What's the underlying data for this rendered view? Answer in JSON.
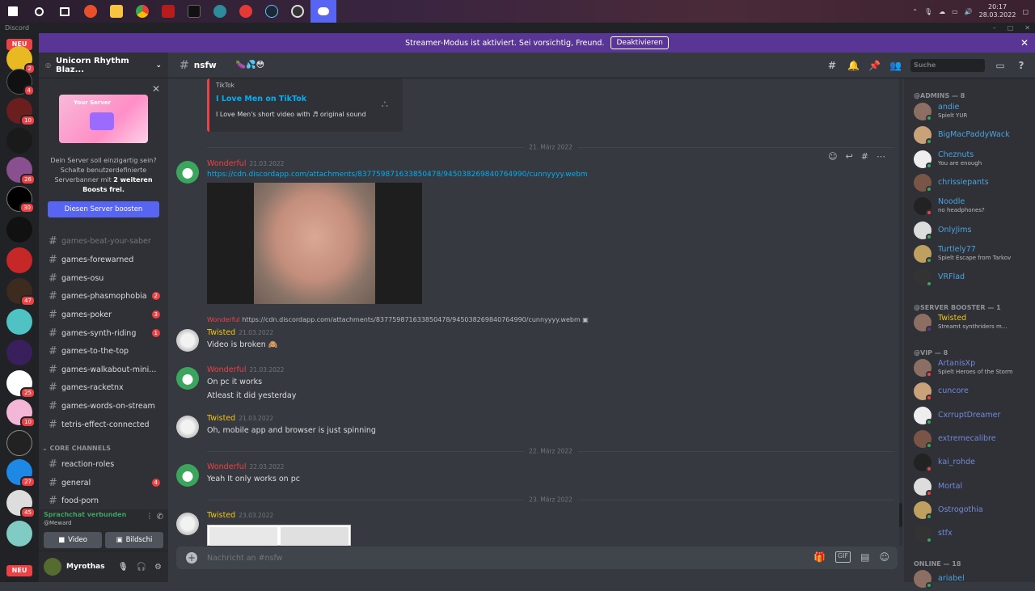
{
  "taskbar": {
    "clock_time": "20:17",
    "clock_date": "28.03.2022",
    "icons": [
      "windows-start-icon",
      "search-icon",
      "task-view-icon",
      "app-red-icon",
      "file-explorer-icon",
      "chrome-icon",
      "app-dark-red-icon",
      "terminal-icon",
      "app-blue-icon",
      "app-orange-icon",
      "steam-icon",
      "obs-icon",
      "discord-icon"
    ]
  },
  "app_title": "Discord",
  "banner": {
    "text": "Streamer-Modus ist aktiviert. Sei vorsichtig, Freund.",
    "button": "Deaktivieren"
  },
  "guilds": {
    "new_label": "NEU",
    "badges": [
      "2",
      "4",
      "10",
      "26",
      "30",
      "47",
      "25",
      "10",
      "27",
      "45"
    ]
  },
  "server": {
    "name": "Unicorn Rhythm Blaz...",
    "boost_text_1": "Dein Server soll einzigartig sein?",
    "boost_text_2": "Schalte benutzerdefinierte",
    "boost_text_3": "Serverbanner mit",
    "boost_bold": "2 weiteren",
    "boost_text_4": "Boosts frei.",
    "boost_image_label": "Your Server",
    "boost_button": "Diesen Server boosten"
  },
  "channels": [
    {
      "name": "games-beat-your-saber",
      "badge": ""
    },
    {
      "name": "games-forewarned",
      "badge": ""
    },
    {
      "name": "games-osu",
      "badge": ""
    },
    {
      "name": "games-phasmophobia",
      "badge": "2"
    },
    {
      "name": "games-poker",
      "badge": "3"
    },
    {
      "name": "games-synth-riding",
      "badge": "1"
    },
    {
      "name": "games-to-the-top",
      "badge": ""
    },
    {
      "name": "games-walkabout-mini...",
      "badge": ""
    },
    {
      "name": "games-racketnx",
      "badge": ""
    },
    {
      "name": "games-words-on-stream",
      "badge": ""
    },
    {
      "name": "tetris-effect-connected",
      "badge": ""
    }
  ],
  "category_core": "CORE CHANNELS",
  "core_channels": [
    {
      "name": "reaction-roles",
      "badge": ""
    },
    {
      "name": "general",
      "badge": "4"
    },
    {
      "name": "food-porn",
      "badge": ""
    }
  ],
  "voice": {
    "status": "Sprachchat verbunden",
    "channel": "@Meward",
    "video": "Video",
    "screen": "Bildschi"
  },
  "user": {
    "name": "Myrothas"
  },
  "chat": {
    "channel": "nsfw",
    "search_placeholder": "Suche",
    "composer_placeholder": "Nachricht an #nsfw",
    "gif_label": "GIF"
  },
  "embed": {
    "provider": "TikTok",
    "title": "I Love Men on TikTok",
    "description": "I Love Men's short video with ♬ original sound"
  },
  "dividers": [
    "21. März 2022",
    "22. März 2022",
    "23. März 2022"
  ],
  "messages": [
    {
      "author": "Wonderful",
      "time": "21.03.2022",
      "text": "https://cdn.discordapp.com/attachments/837759871633850478/945038269840764990/cunnyyyy.webm"
    },
    {
      "reply_link": "https://cdn.discordapp.com/attachments/837759871633850478/945038269840764990/cunnyyyy.webm",
      "reply_author": "Wonderful",
      "author": "Twisted",
      "time": "21.03.2022",
      "text": "Video is broken"
    },
    {
      "author": "Wonderful",
      "time": "21.03.2022",
      "text": "On pc it works",
      "text2": "Atleast it did yesterday"
    },
    {
      "author": "Twisted",
      "time": "21.03.2022",
      "text": "Oh, mobile app and browser is just spinning"
    },
    {
      "author": "Wonderful",
      "time": "22.03.2022",
      "text": "Yeah It only works on pc"
    },
    {
      "author": "Twisted",
      "time": "23.03.2022",
      "text": ""
    }
  ],
  "members": {
    "cat_admins": "@ADMINS — 8",
    "admins": [
      {
        "name": "andie",
        "sub": "Spielt YUR",
        "color": "#4aa3df",
        "status": "#3ba55d"
      },
      {
        "name": "BigMacPaddyWack",
        "sub": "",
        "color": "#4aa3df",
        "status": "#3ba55d"
      },
      {
        "name": "Cheznuts",
        "sub": "You are enough",
        "color": "#4aa3df",
        "status": "#3ba55d"
      },
      {
        "name": "chrissiepants",
        "sub": "",
        "color": "#4aa3df",
        "status": "#3ba55d"
      },
      {
        "name": "Noodle",
        "sub": "no headphones?",
        "color": "#4aa3df",
        "status": "#ed4245"
      },
      {
        "name": "OnlyJims",
        "sub": "",
        "color": "#4aa3df",
        "status": "#3ba55d"
      },
      {
        "name": "Turtlely77",
        "sub": "Spielt Escape from Tarkov",
        "color": "#4aa3df",
        "status": "#3ba55d"
      },
      {
        "name": "VRFlad",
        "sub": "",
        "color": "#4aa3df",
        "status": "#3ba55d"
      }
    ],
    "cat_booster": "@SERVER BOOSTER — 1",
    "boosters": [
      {
        "name": "Twisted",
        "sub": "Streamt synthriders m...",
        "color": "#f0c419",
        "status": "#593695"
      }
    ],
    "cat_vip": "@VIP — 8",
    "vips": [
      {
        "name": "ArtanisXp",
        "sub": "Spielt Heroes of the Storm",
        "color": "#7289da",
        "status": "#ed4245"
      },
      {
        "name": "cuncore",
        "sub": "",
        "color": "#7289da",
        "status": "#ed4245"
      },
      {
        "name": "CxrruptDreamer",
        "sub": "",
        "color": "#7289da",
        "status": "#3ba55d"
      },
      {
        "name": "extremecalibre",
        "sub": "",
        "color": "#7289da",
        "status": "#3ba55d"
      },
      {
        "name": "kai_rohde",
        "sub": "",
        "color": "#7289da",
        "status": "#ed4245"
      },
      {
        "name": "Mortal",
        "sub": "",
        "color": "#7289da",
        "status": "#ed4245"
      },
      {
        "name": "Ostrogothia",
        "sub": "",
        "color": "#7289da",
        "status": "#3ba55d"
      },
      {
        "name": "stfx",
        "sub": "",
        "color": "#7289da",
        "status": "#3ba55d"
      }
    ],
    "cat_online": "ONLINE — 18",
    "online": [
      {
        "name": "ariabel",
        "sub": "",
        "color": "#4aa3df",
        "status": "#3ba55d"
      }
    ]
  }
}
